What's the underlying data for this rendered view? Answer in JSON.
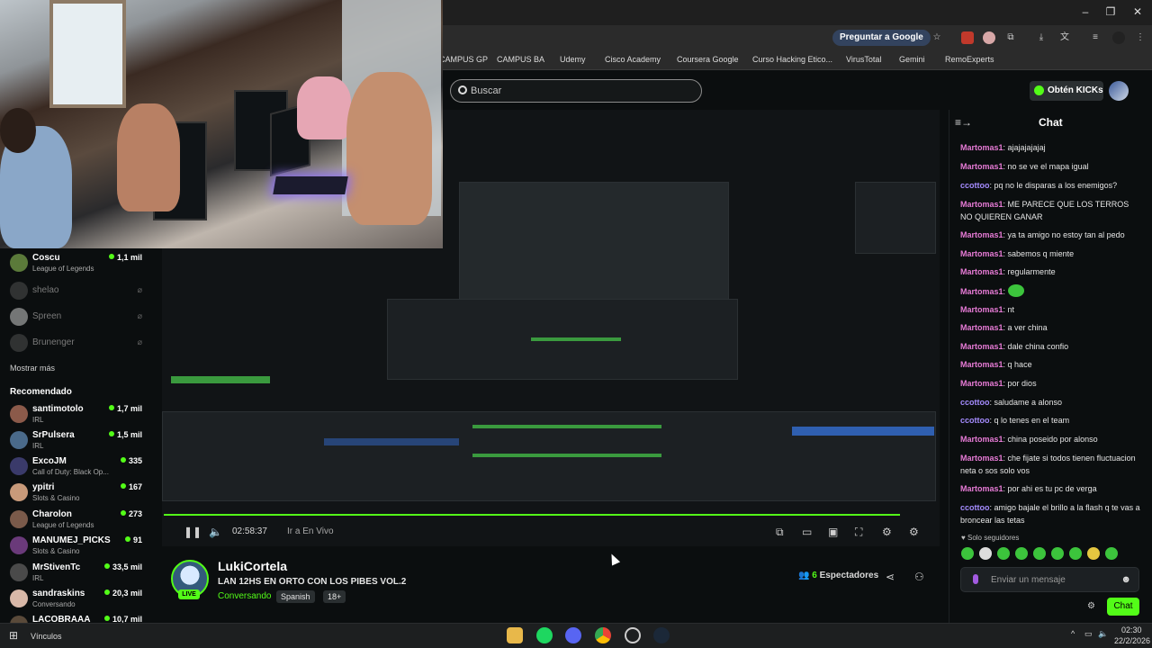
{
  "browser": {
    "ask_google": "Preguntar a Google",
    "bookmarks": [
      "CAMPUS GP",
      "CAMPUS BA",
      "Udemy",
      "Cisco Academy",
      "Coursera Google",
      "Curso Hacking Etico...",
      "VirusTotal",
      "Gemini",
      "RemoExperts"
    ]
  },
  "header": {
    "search_placeholder": "Buscar",
    "kicks_label": "Obtén KICKs"
  },
  "sidebar": {
    "following": [
      {
        "name": "Coscu",
        "category": "League of Legends",
        "viewers": "1,1 mil",
        "live": true
      },
      {
        "name": "shelao",
        "live": false
      },
      {
        "name": "Spreen",
        "live": false
      },
      {
        "name": "Brunenger",
        "live": false
      }
    ],
    "show_more": "Mostrar más",
    "recommended_title": "Recomendado",
    "recommended": [
      {
        "name": "santimotolo",
        "category": "IRL",
        "viewers": "1,7 mil"
      },
      {
        "name": "SrPulsera",
        "category": "IRL",
        "viewers": "1,5 mil"
      },
      {
        "name": "ExcoJM",
        "category": "Call of Duty: Black Op...",
        "viewers": "335"
      },
      {
        "name": "ypitri",
        "category": "Slots & Casino",
        "viewers": "167"
      },
      {
        "name": "Charolon",
        "category": "League of Legends",
        "viewers": "273"
      },
      {
        "name": "MANUMEJ_PICKS",
        "category": "Slots & Casino",
        "viewers": "91"
      },
      {
        "name": "MrStivenTc",
        "category": "IRL",
        "viewers": "33,5 mil"
      },
      {
        "name": "sandraskins",
        "category": "Conversando",
        "viewers": "20,3 mil"
      },
      {
        "name": "LACOBRAAA",
        "category": "",
        "viewers": "10,7 mil"
      }
    ]
  },
  "player": {
    "time": "02:58:37",
    "go_live": "Ir a En Vivo"
  },
  "stream": {
    "streamer": "LukiCortela",
    "live_badge": "LIVE",
    "title": "LAN 12HS EN ORTO CON LOS PIBES VOL.2",
    "category": "Conversando",
    "tags": [
      "Spanish",
      "18+"
    ],
    "viewers_count": "6",
    "viewers_label": "Espectadores"
  },
  "chat": {
    "title": "Chat",
    "messages": [
      {
        "user": "Martomas1",
        "color": "#e77bd6",
        "text": "ajajajajajaj"
      },
      {
        "user": "Martomas1",
        "color": "#e77bd6",
        "text": "no se ve el mapa igual"
      },
      {
        "user": "ccottoo",
        "color": "#a58cff",
        "text": "pq no le disparas a los enemigos?"
      },
      {
        "user": "Martomas1",
        "color": "#e77bd6",
        "text": "ME PARECE QUE LOS TERROS NO QUIEREN GANAR"
      },
      {
        "user": "Martomas1",
        "color": "#e77bd6",
        "text": "ya ta amigo no estoy tan al pedo"
      },
      {
        "user": "Martomas1",
        "color": "#e77bd6",
        "text": "sabemos q miente"
      },
      {
        "user": "Martomas1",
        "color": "#e77bd6",
        "text": "regularmente"
      },
      {
        "user": "Martomas1",
        "color": "#e77bd6",
        "text": "",
        "emote": true
      },
      {
        "user": "Martomas1",
        "color": "#e77bd6",
        "text": "nt"
      },
      {
        "user": "Martomas1",
        "color": "#e77bd6",
        "text": "a ver china"
      },
      {
        "user": "Martomas1",
        "color": "#e77bd6",
        "text": "dale china confio"
      },
      {
        "user": "Martomas1",
        "color": "#e77bd6",
        "text": "q hace"
      },
      {
        "user": "Martomas1",
        "color": "#e77bd6",
        "text": "por dios"
      },
      {
        "user": "ccottoo",
        "color": "#a58cff",
        "text": "saludame a alonso"
      },
      {
        "user": "ccottoo",
        "color": "#a58cff",
        "text": "q lo tenes en el team"
      },
      {
        "user": "Martomas1",
        "color": "#e77bd6",
        "text": "china poseido por alonso"
      },
      {
        "user": "Martomas1",
        "color": "#e77bd6",
        "text": "che fijate si todos tienen fluctuacion neta o sos solo vos"
      },
      {
        "user": "Martomas1",
        "color": "#e77bd6",
        "text": "por ahi es tu pc de verga"
      },
      {
        "user": "ccottoo",
        "color": "#a58cff",
        "text": "amigo bajale el brillo a la flash q te vas a broncear las tetas"
      }
    ],
    "only_followers": "Solo seguidores",
    "input_placeholder": "Enviar un mensaje",
    "send_label": "Chat"
  },
  "taskbar": {
    "links_label": "Vínculos",
    "time": "02:30",
    "date": "22/2/2026"
  },
  "colors": {
    "accent": "#53fc18",
    "bg": "#0b0e0f"
  }
}
